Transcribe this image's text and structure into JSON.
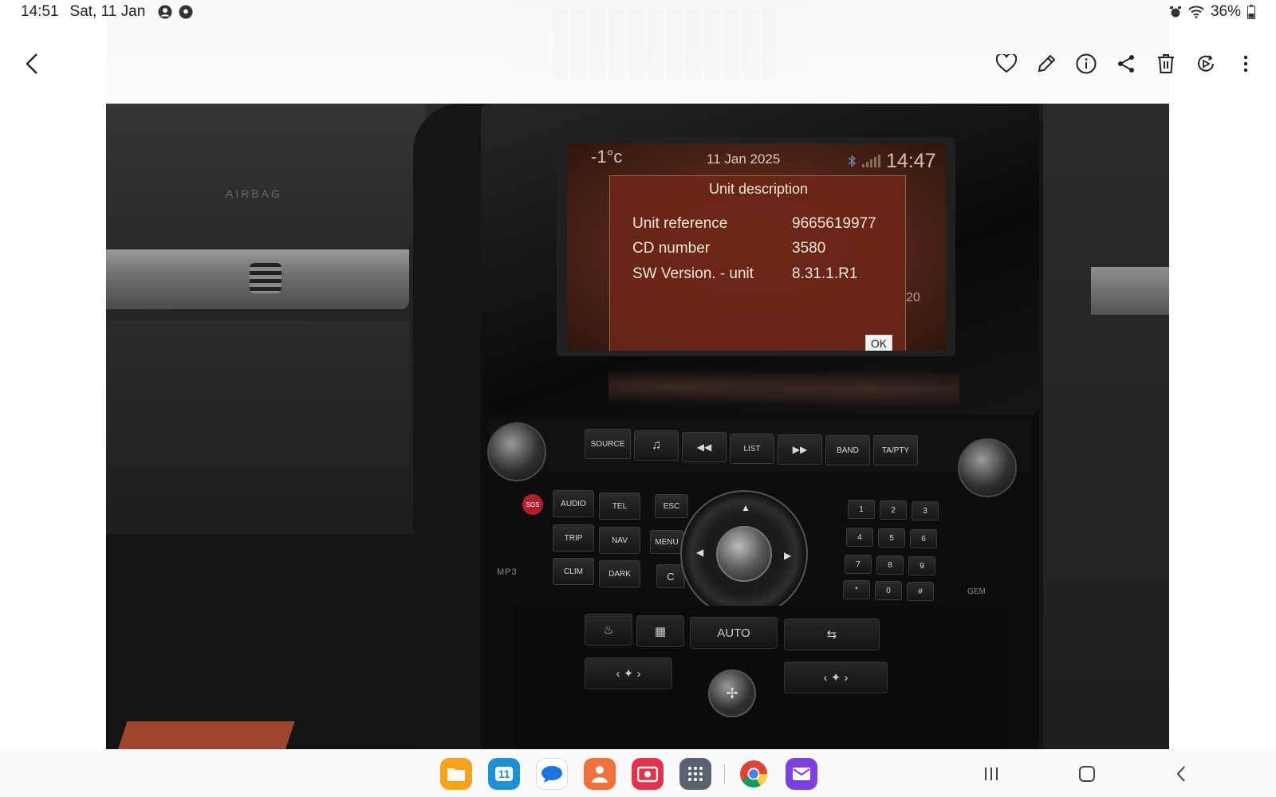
{
  "status_bar": {
    "time": "14:51",
    "date": "Sat, 11 Jan",
    "battery": "36%",
    "icons": [
      "account-icon",
      "football-icon",
      "alarm-icon",
      "wifi-icon",
      "battery-icon"
    ]
  },
  "toolbar": {
    "back": "back-arrow-icon",
    "actions": [
      "favorite-heart-icon",
      "edit-pencil-icon",
      "info-icon",
      "share-icon",
      "delete-trash-icon",
      "remaster-icon",
      "more-options-icon"
    ]
  },
  "photo": {
    "dashboard_label": "AIRBAG",
    "side_label_mp3": "MP3",
    "side_label_gem": "GEM",
    "screen": {
      "temperature": "-1°c",
      "date": "11 Jan  2025",
      "time": "14:47",
      "side_number": "20",
      "dialog": {
        "title": "Unit description",
        "rows": [
          {
            "label": "Unit reference",
            "value": "9665619977"
          },
          {
            "label": "CD number",
            "value": "3580"
          },
          {
            "label": "SW Version. - unit",
            "value": "8.31.1.R1"
          }
        ],
        "ok_label": "OK"
      }
    },
    "panel_buttons_row1": [
      "SOURCE",
      "♫",
      "◀◀",
      "LIST",
      "▶▶",
      "BAND",
      "TA/PTY"
    ],
    "panel_buttons_left": [
      "AUDIO",
      "TEL",
      "TRIP",
      "NAV",
      "CLIM",
      "DARK"
    ],
    "panel_buttons_mid": [
      "ESC",
      "MENU",
      "C"
    ],
    "keypad": [
      "1",
      "2",
      "3",
      "4",
      "5",
      "6",
      "7",
      "8",
      "9",
      "*",
      "0",
      "#"
    ],
    "sos_label": "SOS",
    "climate_label": "AUTO"
  },
  "dock": {
    "apps": [
      {
        "name": "my-files",
        "color": "#f6a21d",
        "glyph": ""
      },
      {
        "name": "calendar",
        "color": "#1d8fd6",
        "glyph": "11"
      },
      {
        "name": "messages",
        "color": "#ffffff",
        "glyph": ""
      },
      {
        "name": "contacts",
        "color": "#f0703a",
        "glyph": ""
      },
      {
        "name": "screen-recorder",
        "color": "#e5304e",
        "glyph": ""
      },
      {
        "name": "app-drawer",
        "color": "#5a6270",
        "glyph": ""
      },
      {
        "name": "chrome",
        "color": "#ffffff",
        "glyph": ""
      },
      {
        "name": "email",
        "color": "#7b3fe4",
        "glyph": ""
      }
    ],
    "nav": [
      "recent-apps-icon",
      "home-icon",
      "back-icon"
    ]
  }
}
